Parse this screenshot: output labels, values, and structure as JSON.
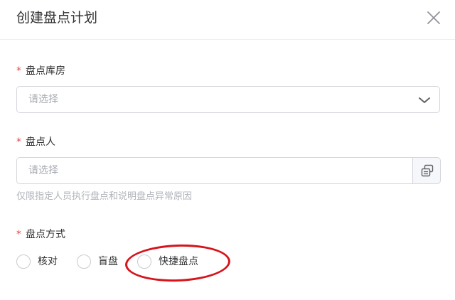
{
  "dialog": {
    "title": "创建盘点计划"
  },
  "form": {
    "warehouse": {
      "required_mark": "*",
      "label": "盘点库房",
      "placeholder": "请选择"
    },
    "counter": {
      "required_mark": "*",
      "label": "盘点人",
      "placeholder": "请选择",
      "hint": "仅限指定人员执行盘点和说明盘点异常原因"
    },
    "method": {
      "required_mark": "*",
      "label": "盘点方式",
      "options": [
        {
          "label": "核对",
          "selected": false
        },
        {
          "label": "盲盘",
          "selected": false
        },
        {
          "label": "快捷盘点",
          "selected": false
        }
      ]
    }
  },
  "annotation": {
    "color": "#d6141b",
    "target": "快捷盘点"
  },
  "colors": {
    "required": "#e04a4a",
    "border": "#d3d6dc",
    "placeholder": "#a8abb2",
    "hint": "#b0b3b9"
  }
}
